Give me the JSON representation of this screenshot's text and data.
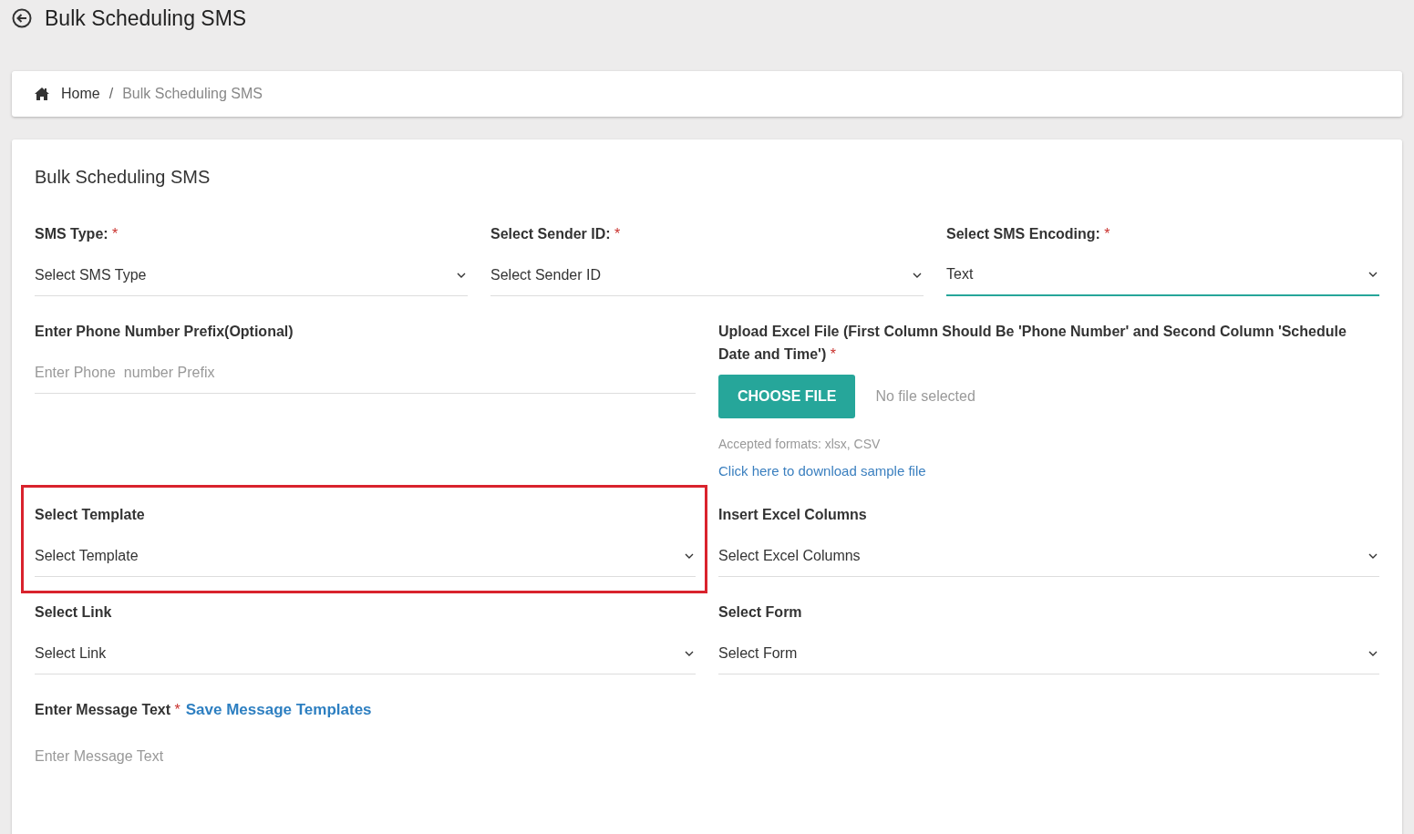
{
  "page_title": "Bulk Scheduling SMS",
  "breadcrumb": {
    "separator": "/",
    "items": [
      {
        "label": "Home",
        "kind": "home"
      },
      {
        "label": "Bulk Scheduling SMS",
        "kind": "current"
      }
    ]
  },
  "card_title": "Bulk Scheduling SMS",
  "rows": [
    {
      "fields": [
        {
          "kind": "select",
          "label": "SMS Type:",
          "required_mark": "*",
          "value": "Select SMS Type",
          "focused": false
        },
        {
          "kind": "select",
          "label": "Select Sender ID:",
          "required_mark": "*",
          "value": "Select Sender ID",
          "focused": false
        },
        {
          "kind": "select",
          "label": "Select SMS Encoding:",
          "required_mark": "*",
          "value": "Text",
          "focused": true
        }
      ]
    },
    {
      "fields": [
        {
          "kind": "input",
          "label": "Enter Phone Number Prefix(Optional)",
          "placeholder": "Enter Phone  number Prefix"
        },
        {
          "kind": "upload",
          "label": "Upload Excel File (First Column Should Be 'Phone Number' and Second Column 'Schedule Date and Time')",
          "required_mark": "*",
          "button": "CHOOSE FILE",
          "status": "No file selected",
          "hint": "Accepted formats: xlsx, CSV",
          "link": "Click here to download sample file"
        }
      ]
    },
    {
      "fields": [
        {
          "kind": "select",
          "label": "Select Template",
          "value": "Select Template",
          "focused": false,
          "highlighted": true
        },
        {
          "kind": "select",
          "label": "Insert Excel Columns",
          "value": "Select Excel Columns",
          "focused": false
        }
      ]
    },
    {
      "fields": [
        {
          "kind": "select",
          "label": "Select Link",
          "value": "Select Link",
          "focused": false
        },
        {
          "kind": "select",
          "label": "Select Form",
          "value": "Select Form",
          "focused": false
        }
      ]
    },
    {
      "fields": [
        {
          "kind": "textarea",
          "label": "Enter Message Text",
          "required_mark": "*",
          "link": "Save Message Templates",
          "placeholder": "Enter Message Text"
        }
      ]
    }
  ]
}
